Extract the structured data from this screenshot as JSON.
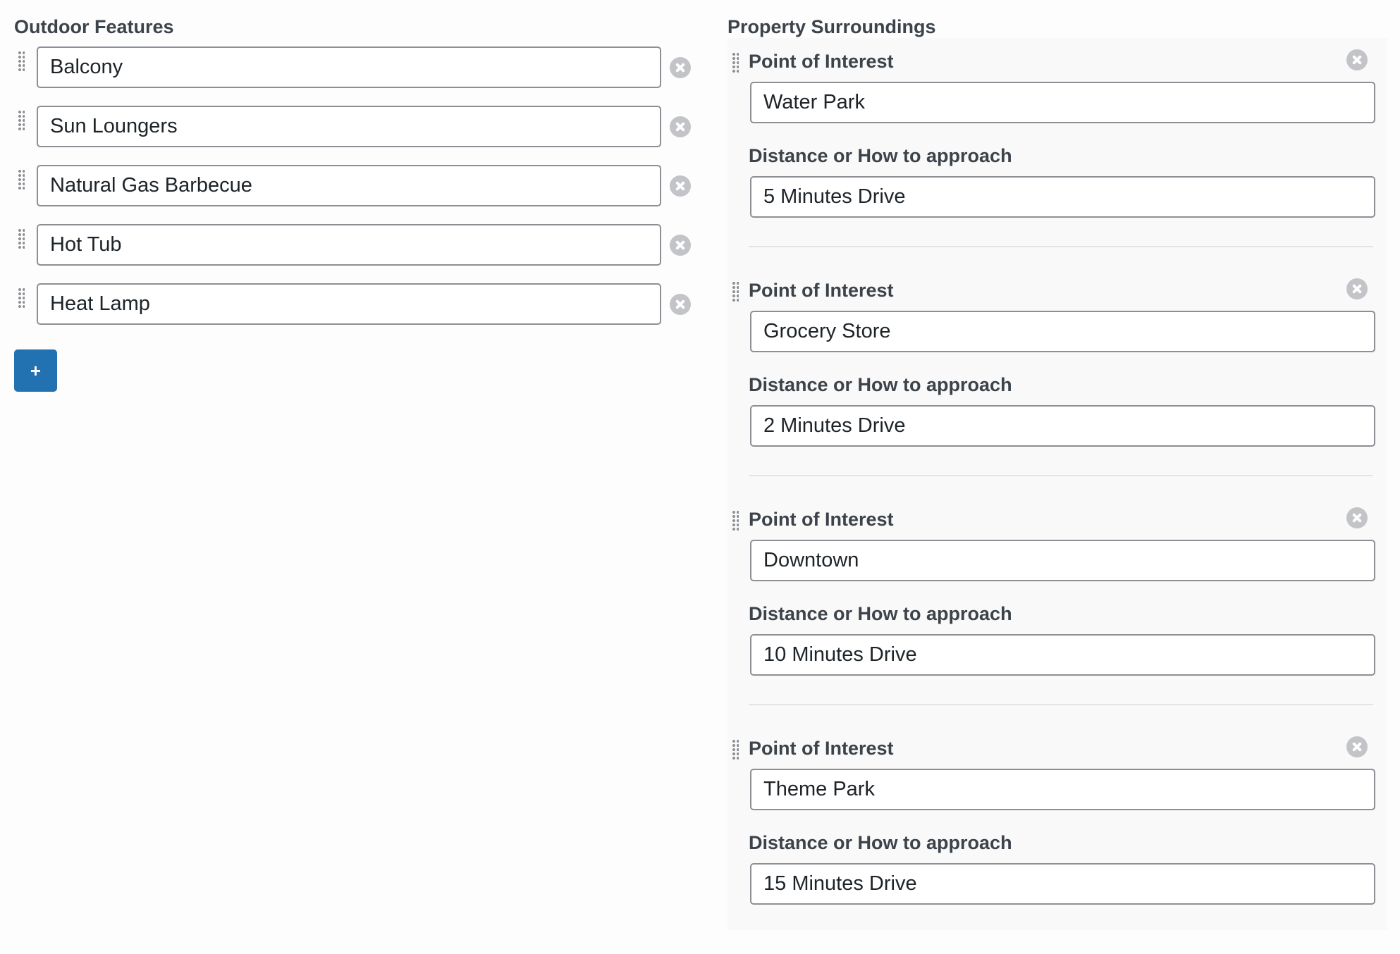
{
  "outdoor_features": {
    "title": "Outdoor Features",
    "items": [
      "Balcony",
      "Sun Loungers",
      "Natural Gas Barbecue",
      "Hot Tub",
      "Heat Lamp"
    ],
    "add_label": "+"
  },
  "property_surroundings": {
    "title": "Property Surroundings",
    "poi_label": "Point of Interest",
    "distance_label": "Distance or How to approach",
    "items": [
      {
        "point": "Water Park",
        "distance": "5 Minutes Drive"
      },
      {
        "point": "Grocery Store",
        "distance": "2 Minutes Drive"
      },
      {
        "point": "Downtown",
        "distance": "10 Minutes Drive"
      },
      {
        "point": "Theme Park",
        "distance": "15 Minutes Drive"
      }
    ]
  },
  "colors": {
    "add_button": "#2271b1",
    "input_border": "#8c8f94",
    "remove_icon": "#c3c4c7",
    "panel_background": "#f9f9f9"
  }
}
